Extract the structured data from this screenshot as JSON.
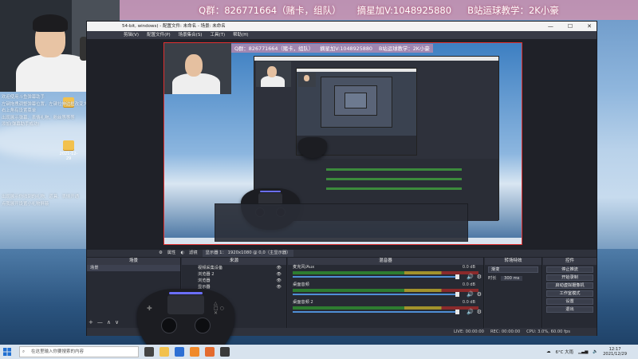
{
  "banner": {
    "qq_group": "Q群：826771664（赌卡，组队）",
    "star_wechat": "摘星加V:1048925880",
    "bilibili": "B站运球教学：2K小豪"
  },
  "side_text": {
    "lines": [
      "欢迎使用斗鱼弹幕助手",
      "左键拖拽调整弹幕位置，左键拉伸边框改变大小",
      "右上角有设置菜单",
      "出现展示弹幕、表情礼物，粉丝等等等",
      "添加(弹幕助手成功)"
    ],
    "lines_2": [
      "出现展示你收到的礼物、道具、表情开通",
      "点我展开设置小礼物屏蔽"
    ]
  },
  "desktop": {
    "icons": [
      "2021-12-29",
      "2021-12-29"
    ]
  },
  "obs": {
    "title": "54-bit, windows) - 配置文件: 未命名 - 场景: 未命名",
    "menu": [
      "剪辑(V)",
      "配置文件(P)",
      "场景集合(S)",
      "工具(T)",
      "帮助(H)"
    ],
    "window_controls": [
      "—",
      "☐",
      "✕"
    ],
    "preview_toolbar": {
      "display_label": "显示器 1： 1920x1080 @ 0,0（主显示器）",
      "prop_button": "属性",
      "filter_button": "滤镜",
      "source_label": "显示器采集"
    },
    "scenes": {
      "header": "场景",
      "items": [
        "场景"
      ]
    },
    "sources": {
      "header": "来源",
      "items": [
        "视频采集设备",
        "浏览器 2",
        "浏览器",
        "显示器"
      ]
    },
    "mixer": {
      "header": "混音器",
      "channels": [
        {
          "name": "麦克风/Aux",
          "db": "0.0 dB"
        },
        {
          "name": "桌面音频",
          "db": "0.0 dB"
        },
        {
          "name": "桌面音频 2",
          "db": "0.0 dB"
        }
      ]
    },
    "transitions": {
      "header": "转场特效",
      "fade": "渐变",
      "duration_label": "时长",
      "duration_value": "300 ms"
    },
    "controls": {
      "header": "控件",
      "buttons": [
        "停止推流",
        "开始录制",
        "启动虚拟摄像机",
        "工作室模式",
        "设置",
        "退出"
      ]
    },
    "status": {
      "live": "LIVE: 00:00:00",
      "rec": "REC: 00:00:00",
      "cpu": "CPU: 3.0%, 60.00 fps"
    }
  },
  "taskbar": {
    "search_placeholder": "在这里输入你要搜索的内容",
    "weather": "6°C 大雨",
    "time": "12:17",
    "date": "2021/12/29"
  },
  "colors": {
    "banner_bg": "#ff8ca0",
    "obs_panel": "#2b2e38",
    "selection_red": "#e03030",
    "controller_accent": "#6b6fff"
  }
}
